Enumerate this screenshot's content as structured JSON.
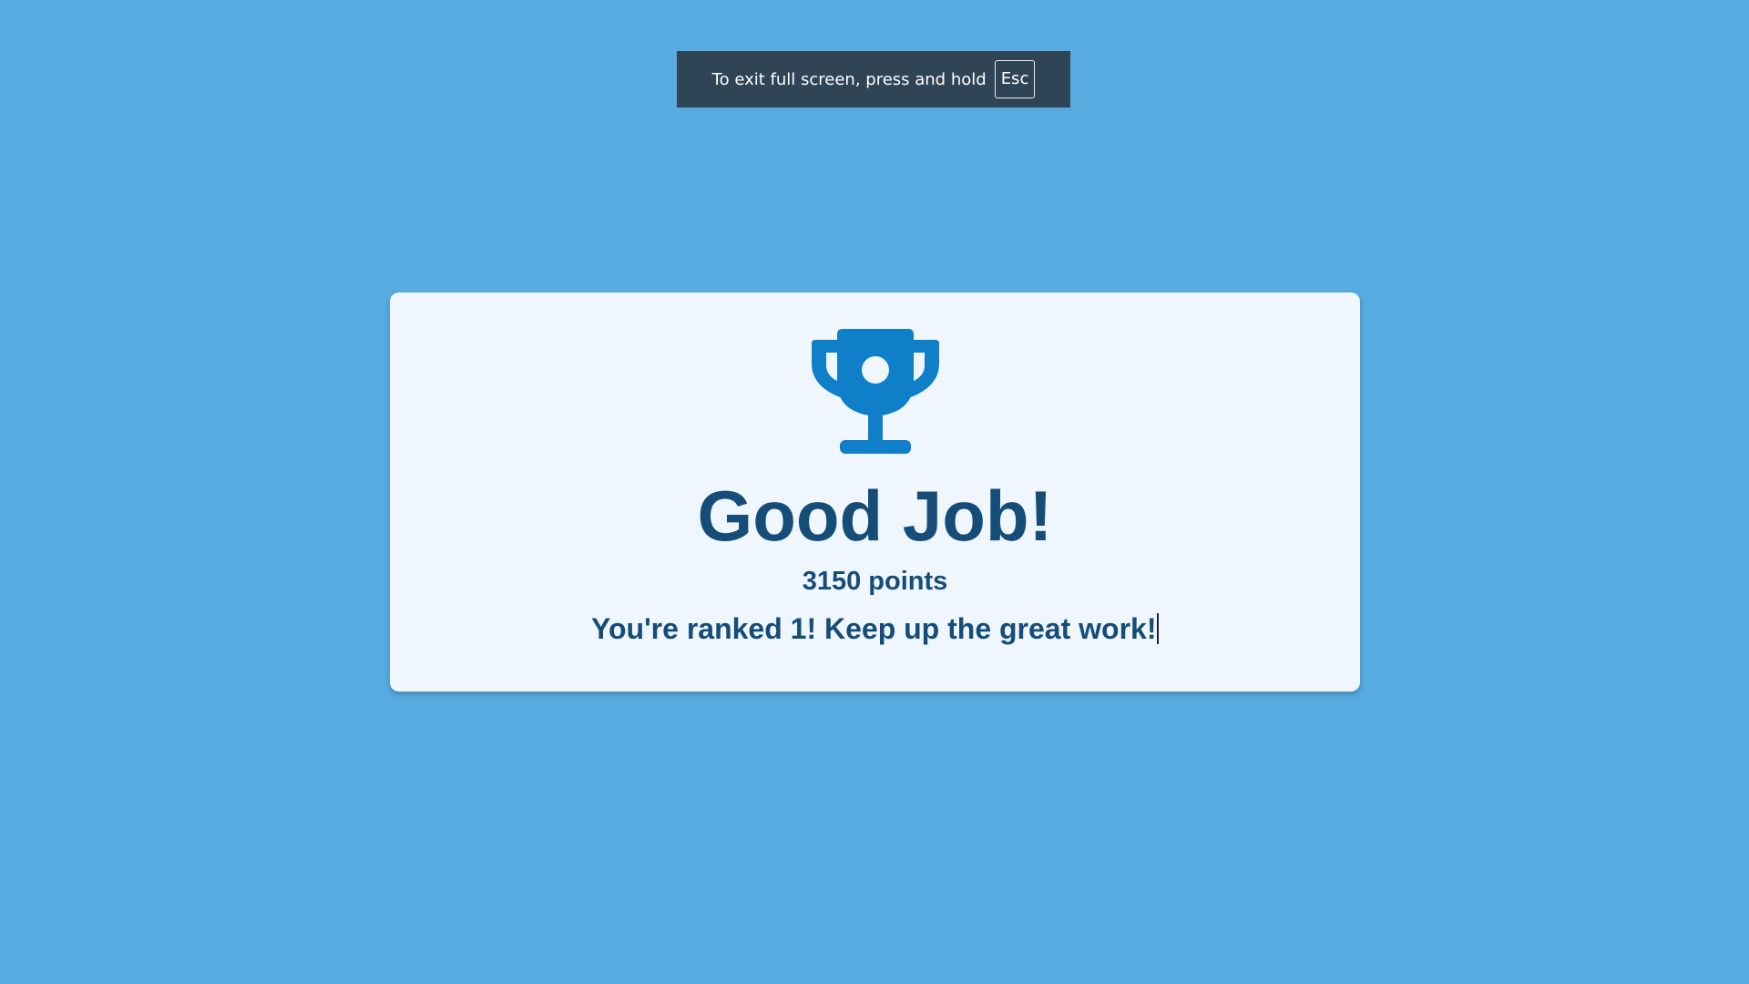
{
  "fullscreen_notice": {
    "message": "To exit full screen, press and hold",
    "key": "Esc"
  },
  "result_card": {
    "icon": "trophy-icon",
    "title": "Good Job!",
    "points_text": "3150 points",
    "rank_text": "You're ranked 1! Keep up the great work!"
  },
  "colors": {
    "background": "#58abe0",
    "card_background": "#eff6fe",
    "text": "#154d78",
    "trophy": "#0e7fc8",
    "banner": "#2f4556"
  }
}
